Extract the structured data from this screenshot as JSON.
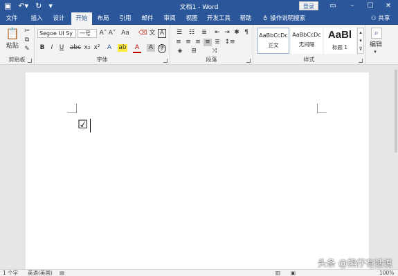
{
  "title_bar": {
    "title": "文档1 - Word",
    "login_label": "登录",
    "quick_access": {
      "save_icon": "save-icon",
      "undo_icon": "undo-icon",
      "redo_icon": "redo-icon",
      "customize_icon": "customize-qat-icon"
    },
    "window_controls": [
      "restore-ribbon-icon",
      "minimize-icon",
      "maximize-icon",
      "close-icon"
    ]
  },
  "tabs": [
    {
      "label": "文件"
    },
    {
      "label": "插入"
    },
    {
      "label": "设计"
    },
    {
      "label": "开始",
      "active": true
    },
    {
      "label": "布局"
    },
    {
      "label": "引用"
    },
    {
      "label": "邮件"
    },
    {
      "label": "审阅"
    },
    {
      "label": "视图"
    },
    {
      "label": "开发工具"
    },
    {
      "label": "帮助"
    }
  ],
  "tell_me": "操作说明搜索",
  "share": "共享",
  "ribbon": {
    "clipboard": {
      "label": "剪贴板",
      "paste_label": "粘贴"
    },
    "font": {
      "label": "字体",
      "font_name": "Segoe UI Sy",
      "font_size": "一号",
      "bold": "B",
      "italic": "I",
      "underline": "U",
      "strikethrough": "abc",
      "subscript": "x₂",
      "superscript": "x²",
      "grow": "A˄",
      "shrink": "A˅",
      "change_case": "Aa",
      "font_color_glyph": "A",
      "highlight_glyph": "ab",
      "text_effects_glyph": "A"
    },
    "paragraph": {
      "label": "段落"
    },
    "styles": {
      "label": "样式",
      "items": [
        {
          "sample": "AaBbCcDc",
          "name": "正文"
        },
        {
          "sample": "AaBbCcDc",
          "name": "无间隔"
        },
        {
          "sample": "AaBl",
          "name": "标题 1"
        }
      ]
    },
    "editing": {
      "label": "编辑"
    }
  },
  "document": {
    "content": "☑"
  },
  "status_bar": {
    "page_info": "1 个字",
    "language": "英语(美国)",
    "zoom": "100%"
  },
  "watermark": "头条 @熊仔有话说"
}
